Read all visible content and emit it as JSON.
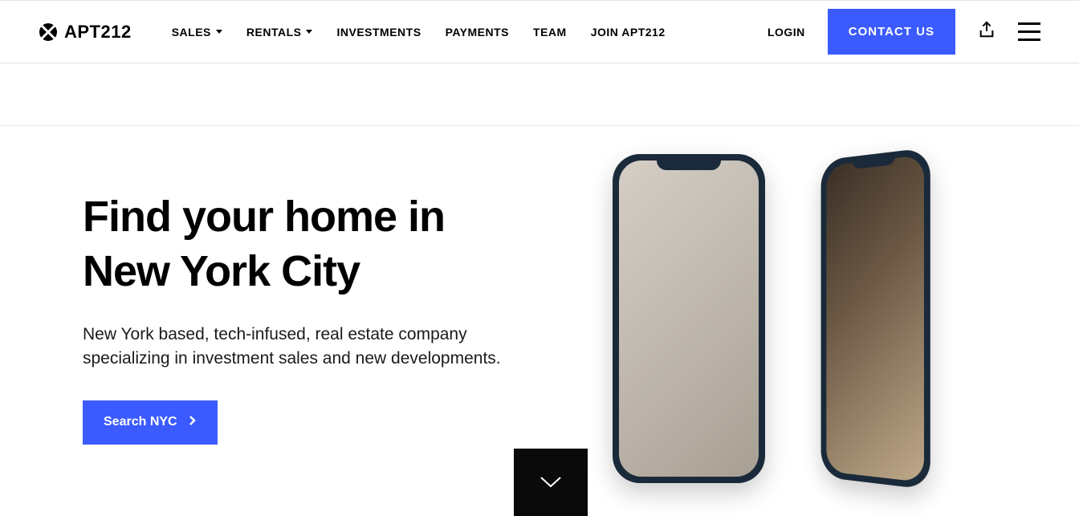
{
  "logo": {
    "text": "APT212"
  },
  "nav": {
    "sales": "SALES",
    "rentals": "RENTALS",
    "investments": "INVESTMENTS",
    "payments": "PAYMENTS",
    "team": "TEAM",
    "join": "JOIN APT212"
  },
  "actions": {
    "login": "LOGIN",
    "contact": "CONTACT US"
  },
  "hero": {
    "title": "Find your home in New York City",
    "subtitle": "New York based, tech-infused, real estate company specializing in investment sales and new developments.",
    "search_label": "Search NYC"
  }
}
